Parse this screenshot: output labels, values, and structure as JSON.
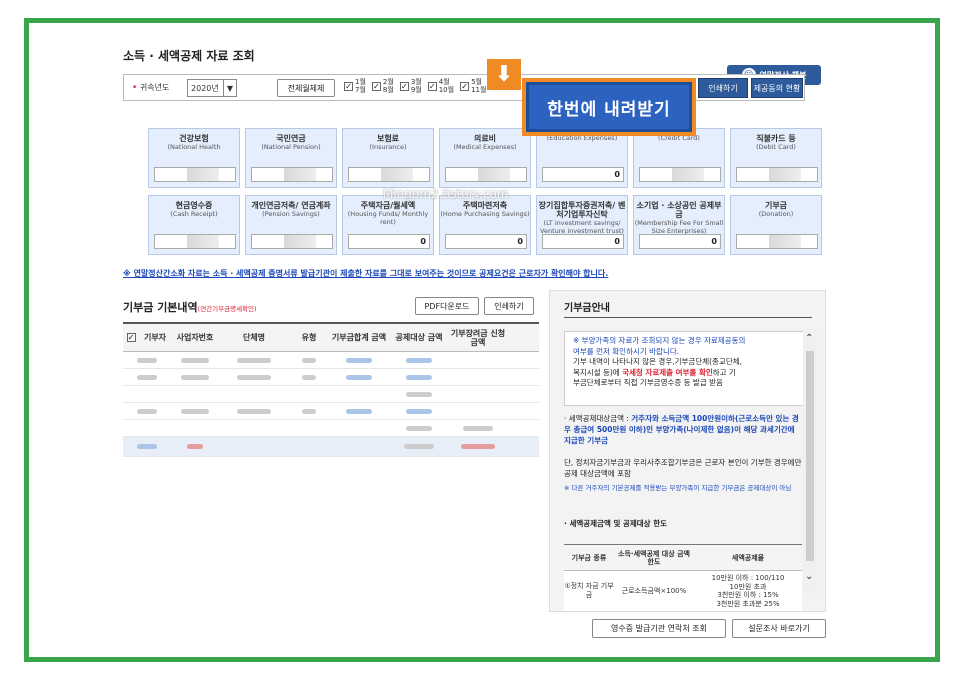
{
  "header": {
    "title": "소득 · 세액공제 자료 조회",
    "kakao_button": "연말정산 챗봇"
  },
  "filter": {
    "year_label": "귀속년도",
    "year_value": "2020년",
    "select_all": "전체월체제",
    "months": [
      [
        "1월",
        "7월"
      ],
      [
        "2월",
        "8월"
      ],
      [
        "3월",
        "9월"
      ],
      [
        "4월",
        "10월"
      ],
      [
        "5월",
        "11월"
      ]
    ],
    "print_button": "인쇄하기",
    "deduction_status_button": "제공동의 현황"
  },
  "download_button": {
    "label": "한번에 내려받기",
    "icon": "download-arrow-icon"
  },
  "cards": [
    {
      "title": "건강보험",
      "sub": "(National Health",
      "value": ""
    },
    {
      "title": "국민연금",
      "sub": "(National Pension)",
      "value": ""
    },
    {
      "title": "보험료",
      "sub": "(Insurance)",
      "value": ""
    },
    {
      "title": "의료비",
      "sub": "(Medical Expenses)",
      "value": ""
    },
    {
      "title": "",
      "sub": "(Education Expenses)",
      "value": "0"
    },
    {
      "title": "",
      "sub": "(Credit Card)",
      "value": ""
    },
    {
      "title": "직불카드 등",
      "sub": "(Debit Card)",
      "value": ""
    },
    {
      "title": "현금영수증",
      "sub": "(Cash Receipt)",
      "value": ""
    },
    {
      "title": "개인연금저축/ 연금계좌",
      "sub": "(Pension Savings)",
      "value": ""
    },
    {
      "title": "주택자금/월세액",
      "sub": "(Housing Funds/ Monthly rent)",
      "value": "0"
    },
    {
      "title": "주택마련저축",
      "sub": "(Home Purchasing Savings)",
      "value": "0"
    },
    {
      "title": "장기집합투자증권저축/ 벤처기업투자신탁",
      "sub": "(LT investment savings/ Venture investment trust)",
      "value": "0"
    },
    {
      "title": "소기업 · 소상공인 공제부금",
      "sub": "(Membership Fee For Small Size Enterprises)",
      "value": "0"
    },
    {
      "title": "기부금",
      "sub": "(Donation)",
      "value": ""
    }
  ],
  "watermark": "Mingom2.tistory.com",
  "notice": "※ 연말정산간소화 자료는 소득 · 세액공제 증명서류 발급기관이 제출한 자료를 그대로 보여주는 것이므로 공제요건은 근로자가 확인해야 합니다.",
  "left": {
    "title": "기부금 기본내역",
    "subtitle": "(연간기부금명세확인)",
    "pdf_button": "PDF다운로드",
    "print_button": "인쇄하기",
    "columns": [
      "기부자",
      "사업자번호",
      "단체명",
      "유형",
      "기부금합계 금액",
      "공제대상 금액",
      "기부장려금 신청금액"
    ]
  },
  "right": {
    "title": "기부금안내",
    "box_lines": [
      "※ 부양가족의 자료가 조회되지 않는 경우 자료제공동의",
      "여부를 먼저 확인하시기 바랍니다.",
      "기부 내역이 나타나지 않은 경우,기부금단체(종교단체,",
      "복지시설 등)에",
      "국세청 자료제출 여부를 확인",
      "하고 기",
      "부금단체로부터 직접 기부금영수증 등 발급 받음"
    ],
    "p1_a": "· 세액공제대상금액 :",
    "p1_b": "거주자와 소득금액 100만원이하(근로소득만 있는 경우 총급여 500만원 이하)인 부양가족(나이제한 없음)이 해당 과세기간에 지급한 기부금",
    "p2": "단, 정치자금기부금과 우리사주조합기부금은 근로자 본인이 기부한 경우에만 공제 대상금액에 포함",
    "p3": "※ 다른 거주자의 기본공제를 적용받는 부양가족이 지급한 기부금은 공제대상이 아님",
    "limit_title": "· 세액공제금액 및 공제대상 한도",
    "limit_cols": [
      "기부금 종류",
      "소득·세액공제 대상 금액 한도",
      "세액공제율"
    ],
    "limit_row": [
      "①정치 자금 기부금",
      "근로소득금액×100%",
      "10만원 이하 : 100/110\n10만원 초과\n3천만원 이하 : 15%\n3천만원 초과분 25%"
    ]
  },
  "footer": {
    "receipt_button": "영수증 발급기관 연락처 조회",
    "survey_button": "설문조사 바로가기"
  },
  "colors": {
    "frame_green": "#3aa54a",
    "brand_blue": "#2d5b9c",
    "highlight_orange": "#f08a24"
  }
}
